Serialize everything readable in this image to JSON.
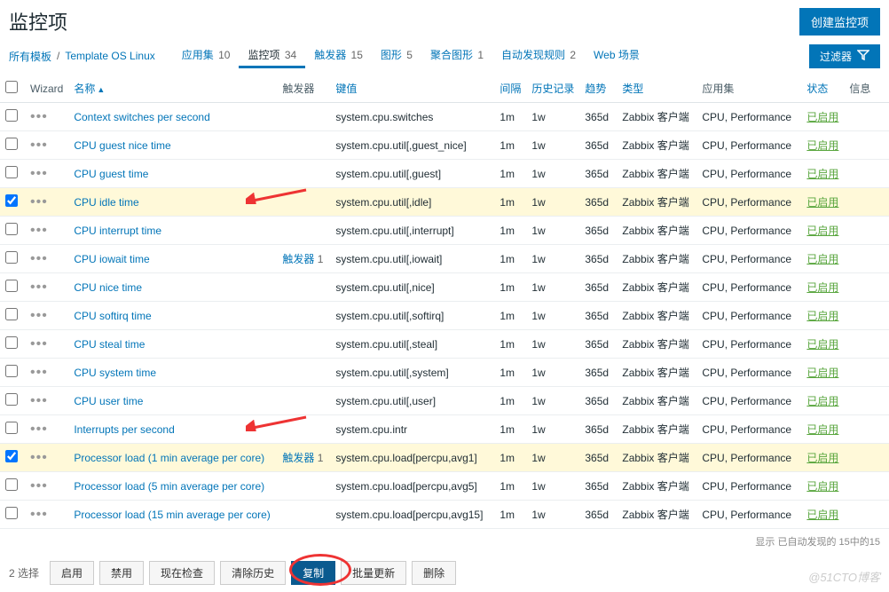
{
  "header": {
    "title": "监控项",
    "create_btn": "创建监控项"
  },
  "breadcrumb": {
    "all_templates": "所有模板",
    "template": "Template OS Linux"
  },
  "tabs": [
    {
      "label": "应用集",
      "count": "10"
    },
    {
      "label": "监控项",
      "count": "34",
      "active": true
    },
    {
      "label": "触发器",
      "count": "15"
    },
    {
      "label": "图形",
      "count": "5"
    },
    {
      "label": "聚合图形",
      "count": "1"
    },
    {
      "label": "自动发现规则",
      "count": "2"
    },
    {
      "label": "Web 场景",
      "count": ""
    }
  ],
  "filter_label": "过滤器",
  "columns": {
    "wizard": "Wizard",
    "name": "名称",
    "triggers": "触发器",
    "key": "键值",
    "interval": "间隔",
    "history": "历史记录",
    "trends": "趋势",
    "type": "类型",
    "apps": "应用集",
    "status": "状态",
    "info": "信息"
  },
  "rows": [
    {
      "name": "Context switches per second",
      "trig": "",
      "key": "system.cpu.switches",
      "int": "1m",
      "hist": "1w",
      "trend": "365d",
      "type": "Zabbix 客户端",
      "apps": "CPU, Performance",
      "stat": "已启用"
    },
    {
      "name": "CPU guest nice time",
      "trig": "",
      "key": "system.cpu.util[,guest_nice]",
      "int": "1m",
      "hist": "1w",
      "trend": "365d",
      "type": "Zabbix 客户端",
      "apps": "CPU, Performance",
      "stat": "已启用"
    },
    {
      "name": "CPU guest time",
      "trig": "",
      "key": "system.cpu.util[,guest]",
      "int": "1m",
      "hist": "1w",
      "trend": "365d",
      "type": "Zabbix 客户端",
      "apps": "CPU, Performance",
      "stat": "已启用"
    },
    {
      "name": "CPU idle time",
      "trig": "",
      "key": "system.cpu.util[,idle]",
      "int": "1m",
      "hist": "1w",
      "trend": "365d",
      "type": "Zabbix 客户端",
      "apps": "CPU, Performance",
      "stat": "已启用",
      "checked": true,
      "hl": true,
      "arrow": true
    },
    {
      "name": "CPU interrupt time",
      "trig": "",
      "key": "system.cpu.util[,interrupt]",
      "int": "1m",
      "hist": "1w",
      "trend": "365d",
      "type": "Zabbix 客户端",
      "apps": "CPU, Performance",
      "stat": "已启用"
    },
    {
      "name": "CPU iowait time",
      "trig": "触发器 1",
      "key": "system.cpu.util[,iowait]",
      "int": "1m",
      "hist": "1w",
      "trend": "365d",
      "type": "Zabbix 客户端",
      "apps": "CPU, Performance",
      "stat": "已启用"
    },
    {
      "name": "CPU nice time",
      "trig": "",
      "key": "system.cpu.util[,nice]",
      "int": "1m",
      "hist": "1w",
      "trend": "365d",
      "type": "Zabbix 客户端",
      "apps": "CPU, Performance",
      "stat": "已启用"
    },
    {
      "name": "CPU softirq time",
      "trig": "",
      "key": "system.cpu.util[,softirq]",
      "int": "1m",
      "hist": "1w",
      "trend": "365d",
      "type": "Zabbix 客户端",
      "apps": "CPU, Performance",
      "stat": "已启用"
    },
    {
      "name": "CPU steal time",
      "trig": "",
      "key": "system.cpu.util[,steal]",
      "int": "1m",
      "hist": "1w",
      "trend": "365d",
      "type": "Zabbix 客户端",
      "apps": "CPU, Performance",
      "stat": "已启用"
    },
    {
      "name": "CPU system time",
      "trig": "",
      "key": "system.cpu.util[,system]",
      "int": "1m",
      "hist": "1w",
      "trend": "365d",
      "type": "Zabbix 客户端",
      "apps": "CPU, Performance",
      "stat": "已启用"
    },
    {
      "name": "CPU user time",
      "trig": "",
      "key": "system.cpu.util[,user]",
      "int": "1m",
      "hist": "1w",
      "trend": "365d",
      "type": "Zabbix 客户端",
      "apps": "CPU, Performance",
      "stat": "已启用"
    },
    {
      "name": "Interrupts per second",
      "trig": "",
      "key": "system.cpu.intr",
      "int": "1m",
      "hist": "1w",
      "trend": "365d",
      "type": "Zabbix 客户端",
      "apps": "CPU, Performance",
      "stat": "已启用",
      "arrow": true
    },
    {
      "name": "Processor load (1 min average per core)",
      "trig": "触发器 1",
      "key": "system.cpu.load[percpu,avg1]",
      "int": "1m",
      "hist": "1w",
      "trend": "365d",
      "type": "Zabbix 客户端",
      "apps": "CPU, Performance",
      "stat": "已启用",
      "checked": true,
      "hl": true
    },
    {
      "name": "Processor load (5 min average per core)",
      "trig": "",
      "key": "system.cpu.load[percpu,avg5]",
      "int": "1m",
      "hist": "1w",
      "trend": "365d",
      "type": "Zabbix 客户端",
      "apps": "CPU, Performance",
      "stat": "已启用"
    },
    {
      "name": "Processor load (15 min average per core)",
      "trig": "",
      "key": "system.cpu.load[percpu,avg15]",
      "int": "1m",
      "hist": "1w",
      "trend": "365d",
      "type": "Zabbix 客户端",
      "apps": "CPU, Performance",
      "stat": "已启用"
    }
  ],
  "footer_info": "显示 已自动发现的 15中的15",
  "actions": {
    "selected": "2 选择",
    "buttons": [
      {
        "label": "启用"
      },
      {
        "label": "禁用"
      },
      {
        "label": "现在检查"
      },
      {
        "label": "清除历史"
      },
      {
        "label": "复制",
        "sel": true
      },
      {
        "label": "批量更新"
      },
      {
        "label": "删除"
      }
    ]
  },
  "watermark": "@51CTO博客"
}
